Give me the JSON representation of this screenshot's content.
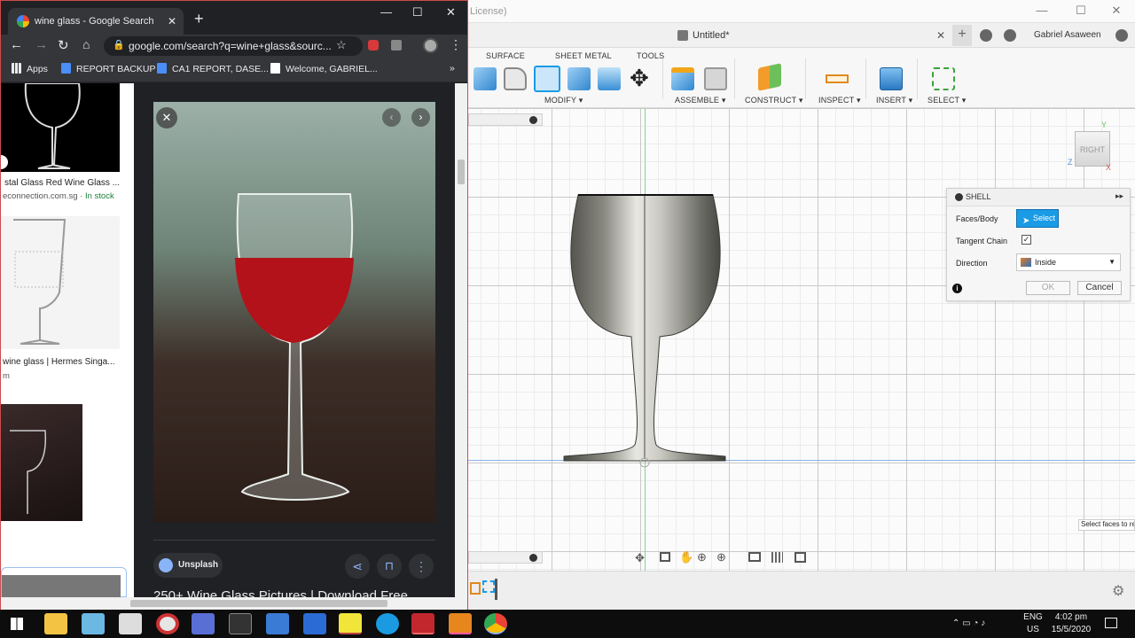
{
  "browser": {
    "tab_title": "wine glass - Google Search",
    "url": "google.com/search?q=wine+glass&sourc...",
    "bookmarks": [
      "Apps",
      "REPORT BACKUP",
      "CA1 REPORT, DASE...",
      "Welcome, GABRIEL..."
    ],
    "bookmarks_overflow": "»",
    "results": [
      {
        "title": "stal Glass Red Wine Glass ...",
        "source": "econnection.com.sg",
        "sep": " · ",
        "stock": "In stock"
      },
      {
        "title": "wine glass | Hermes Singa...",
        "source": "m"
      }
    ],
    "viewer": {
      "source_name": "Unsplash",
      "caption": "250+ Wine Glass Pictures | Download Free"
    }
  },
  "fusion": {
    "title_partial": "License)",
    "doc_name": "Untitled*",
    "user": "Gabriel Asaween",
    "tabs": [
      "SURFACE",
      "SHEET METAL",
      "TOOLS"
    ],
    "groups": [
      "MODIFY ▾",
      "ASSEMBLE ▾",
      "CONSTRUCT ▾",
      "INSPECT ▾",
      "INSERT ▾",
      "SELECT ▾"
    ],
    "viewcube": {
      "face": "RIGHT",
      "y": "Y",
      "z": "Z",
      "x": "X"
    },
    "shell": {
      "title": "SHELL",
      "faces_label": "Faces/Body",
      "select_label": "Select",
      "tangent_label": "Tangent Chain",
      "tangent_checked": true,
      "direction_label": "Direction",
      "direction_value": "Inside",
      "ok": "OK",
      "cancel": "Cancel"
    },
    "tooltip": "Select faces to re"
  },
  "taskbar": {
    "lang1": "ENG",
    "lang2": "US",
    "time": "4:02 pm",
    "date": "15/5/2020"
  },
  "colors": {
    "accent": "#1a9be6",
    "chrome_dark": "#202124",
    "fusion_bg": "#f2f2f2"
  }
}
